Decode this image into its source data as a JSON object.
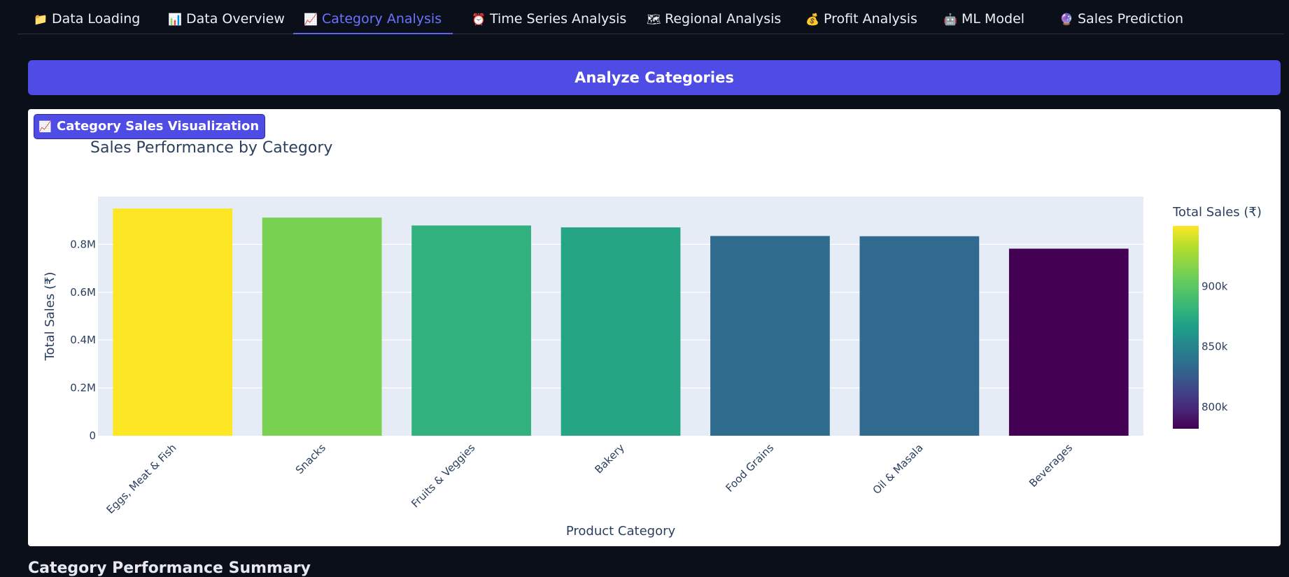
{
  "tabs": [
    {
      "icon": "📁",
      "label": "Data Loading",
      "active": false
    },
    {
      "icon": "📊",
      "label": "Data Overview",
      "active": false
    },
    {
      "icon": "📈",
      "label": "Category Analysis",
      "active": true
    },
    {
      "icon": "⏰",
      "label": "Time Series Analysis",
      "active": false
    },
    {
      "icon": "🗺",
      "label": "Regional Analysis",
      "active": false
    },
    {
      "icon": "💰",
      "label": "Profit Analysis",
      "active": false
    },
    {
      "icon": "🤖",
      "label": "ML Model",
      "active": false
    },
    {
      "icon": "🔮",
      "label": "Sales Prediction",
      "active": false
    }
  ],
  "analyze_button": "Analyze Categories",
  "viz_badge": {
    "icon": "📈",
    "label": "Category Sales Visualization"
  },
  "bottom_text": "Category Performance Summary",
  "chart_data": {
    "type": "bar",
    "title": "Sales Performance by Category",
    "xlabel": "Product Category",
    "ylabel": "Total Sales (₹)",
    "categories": [
      "Eggs, Meat & Fish",
      "Snacks",
      "Fruits & Veggies",
      "Bakery",
      "Food Grains",
      "Oil & Masala",
      "Beverages"
    ],
    "values": [
      950000,
      912000,
      879000,
      871000,
      835000,
      834000,
      782000
    ],
    "ylim": [
      0,
      1000000
    ],
    "y_ticks": [
      {
        "v": 0,
        "label": "0"
      },
      {
        "v": 200000,
        "label": "0.2M"
      },
      {
        "v": 400000,
        "label": "0.4M"
      },
      {
        "v": 600000,
        "label": "0.6M"
      },
      {
        "v": 800000,
        "label": "0.8M"
      }
    ],
    "colorbar": {
      "title": "Total Sales (₹)",
      "range": [
        782000,
        950000
      ],
      "ticks": [
        {
          "v": 800000,
          "label": "800k"
        },
        {
          "v": 850000,
          "label": "850k"
        },
        {
          "v": 900000,
          "label": "900k"
        }
      ],
      "colorscale": "Viridis"
    },
    "grid": true,
    "plot_bg": "#e5ecf6"
  }
}
